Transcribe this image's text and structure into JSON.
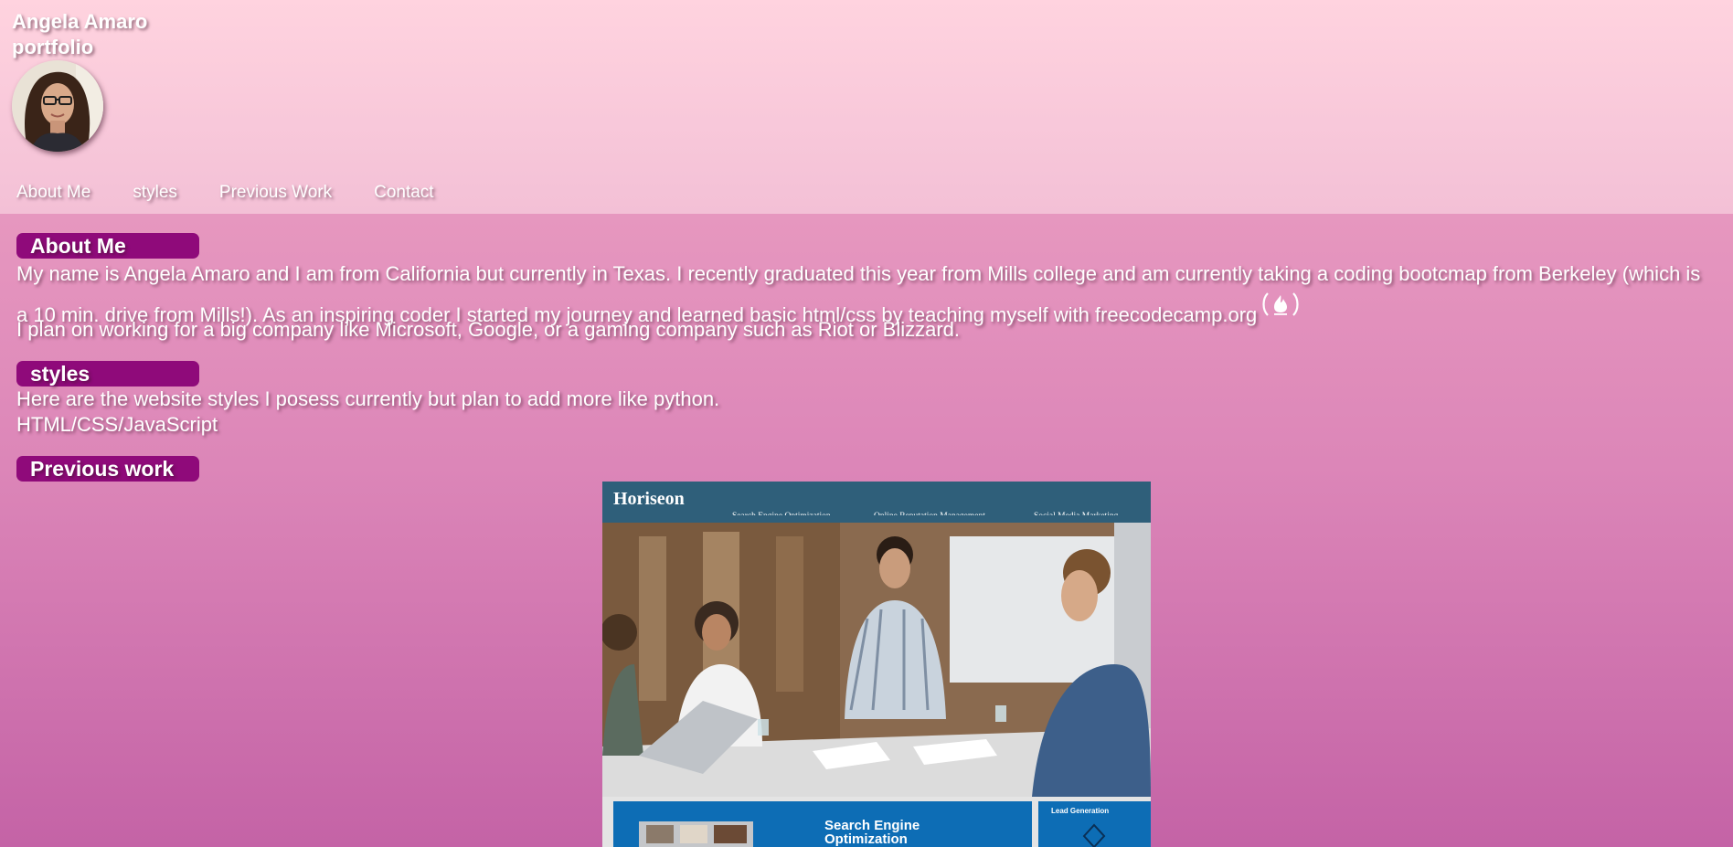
{
  "header": {
    "title_line1": "Angela Amaro",
    "title_line2": "portfolio"
  },
  "nav": {
    "items": [
      "About Me",
      "styles",
      "Previous Work",
      "Contact"
    ]
  },
  "about": {
    "heading": "About Me",
    "paragraph": "My name is Angela Amaro and I am from California but currently in Texas. I recently graduated this year from Mills college and am currently taking a coding bootcmap from Berkeley (which is a 10 min. drive from Mills!). As an inspiring coder I started my journey and learned basic html/css by teaching myself with freecodecamp.org",
    "paragraph2": "I plan on working for a big company like Microsoft, Google, or a gaming company such as Riot or Blizzard.",
    "icon": "freecodecamp-icon"
  },
  "styles": {
    "heading": "styles",
    "line1": "Here are the website styles I posess currently but plan to add more like python.",
    "line2": "HTML/CSS/JavaScript"
  },
  "previous_work": {
    "heading": "Previous work",
    "project": {
      "brand": "Horiseon",
      "nav": [
        "Search Engine Optimization",
        "Online Reputation Management",
        "Social Media Marketing"
      ],
      "card_title_line1": "Search Engine",
      "card_title_line2": "Optimization",
      "side_title": "Lead Generation"
    }
  },
  "colors": {
    "header_top": "#ffd3df",
    "body_bottom": "#c463a6",
    "heading_bg": "#8f0a7a",
    "text": "#ffffff"
  }
}
